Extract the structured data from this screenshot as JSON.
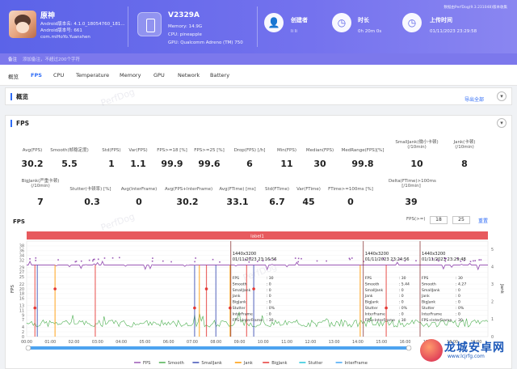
{
  "header": {
    "app": {
      "name": "原神",
      "version": "Android版本名: 4.1.0_18054760_181...",
      "version_code": "Android版本号: 661",
      "package": "com.miHoYo.Yuanshen"
    },
    "device": {
      "name": "V2329A",
      "memory": "Memory: 14.9G",
      "cpu": "CPU: pineapple",
      "gpu": "GPU: Qualcomm Adreno (TM) 750"
    },
    "stats": [
      {
        "label": "创建者",
        "value": "li li",
        "icon": "user-icon",
        "glyph": "👤"
      },
      {
        "label": "时长",
        "value": "0h 20m 0s",
        "icon": "clock-icon",
        "glyph": "◷"
      },
      {
        "label": "上传时间",
        "value": "01/11/2023 23:29:58",
        "icon": "upload-time-icon",
        "glyph": "◷"
      }
    ],
    "version_note": "数据由PerfDog(9.3.231048)版本收集"
  },
  "remark": {
    "label": "备注",
    "placeholder": "添加备注，不超过200个字符"
  },
  "tabs": [
    "概览",
    "FPS",
    "CPU",
    "Temperature",
    "Memory",
    "GPU",
    "Network",
    "Battery"
  ],
  "active_tab": "FPS",
  "overview": {
    "title": "概览",
    "export": "导出全部"
  },
  "fps_section": {
    "title": "FPS",
    "collapse_glyph": "▾",
    "metrics_row1": [
      {
        "label": "Avg(FPS)",
        "value": "30.2"
      },
      {
        "label": "Smooth(帧稳定度)",
        "value": "5.5"
      },
      {
        "label": "Std(FPS)",
        "value": "1"
      },
      {
        "label": "Var(FPS)",
        "value": "1.1"
      },
      {
        "label": "FPS>=18 [%]",
        "value": "99.9"
      },
      {
        "label": "FPS>=25 [%]",
        "value": "99.6"
      },
      {
        "label": "Drop(FPS) [/h]",
        "value": "6"
      },
      {
        "label": "Min(FPS)",
        "value": "11"
      },
      {
        "label": "Median(FPS)",
        "value": "30"
      },
      {
        "label": "MedRange(FPS)[%]",
        "value": "99.8"
      },
      {
        "label": "SmallJank(微小卡顿)\n(/10min)",
        "value": "10"
      },
      {
        "label": "Jank(卡顿)\n(/10min)",
        "value": "8"
      }
    ],
    "metrics_row2": [
      {
        "label": "BigJank(严重卡顿)\n(/10min)",
        "value": "7"
      },
      {
        "label": "Stutter(卡顿率) [%]",
        "value": "0.3"
      },
      {
        "label": "Avg(InterFrame)",
        "value": "0"
      },
      {
        "label": "Avg(FPS+InterFrame)",
        "value": "30.2"
      },
      {
        "label": "Avg(FTime) [ms]",
        "value": "33.1"
      },
      {
        "label": "Std(FTime)",
        "value": "6.7"
      },
      {
        "label": "Var(FTime)",
        "value": "45"
      },
      {
        "label": "FTime>=100ms [%]",
        "value": "0"
      },
      {
        "label": "Delta(FTime)>100ms\n[/10min]",
        "value": "39"
      }
    ]
  },
  "chart_controls": {
    "title": "FPS",
    "range_label": "FPS(>=)",
    "range_low": "18",
    "range_high": "25",
    "reset": "重置"
  },
  "watermark": "PerfDog",
  "chart_data": {
    "type": "line",
    "y_left_label": "FPS",
    "y_right_label": "Jank",
    "label_bar": "label1",
    "ylim": [
      0,
      40
    ],
    "y_ticks": [
      "0",
      "2",
      "4",
      "7",
      "9",
      "11",
      "13",
      "16",
      "18",
      "20",
      "22",
      "25",
      "27",
      "29",
      "32",
      "34",
      "36",
      "38"
    ],
    "y_right_ticks": [
      "0",
      "1",
      "2",
      "3",
      "4",
      "5"
    ],
    "x_ticks": [
      "00:00",
      "01:00",
      "02:00",
      "03:00",
      "04:00",
      "05:00",
      "06:00",
      "07:00",
      "08:00",
      "09:00",
      "10:00",
      "11:00",
      "12:00",
      "13:00",
      "14:00",
      "15:00",
      "16:00",
      "17:00",
      "18:00",
      "19:00"
    ],
    "legend": [
      {
        "name": "FPS",
        "color": "#9b59b6"
      },
      {
        "name": "Smooth",
        "color": "#4caf50"
      },
      {
        "name": "SmallJank",
        "color": "#3f51b5"
      },
      {
        "name": "Jank",
        "color": "#ff9800"
      },
      {
        "name": "BigJank",
        "color": "#e53935"
      },
      {
        "name": "Stutter",
        "color": "#26c6da"
      },
      {
        "name": "InterFrame",
        "color": "#42a5f5"
      }
    ],
    "fps_level": 30,
    "jank_events_minutes": [
      0.35,
      0.45,
      1.2,
      2.9,
      7.1,
      7.3,
      7.6,
      8.0,
      8.6,
      9.3,
      9.6,
      14.1,
      15.2
    ],
    "tooltips": [
      {
        "title": "1440x3200",
        "time": "01/11/2023 23:16:56",
        "rows": [
          [
            "FPS",
            ": 30"
          ],
          [
            "Smooth",
            ": 0"
          ],
          [
            "SmallJank",
            ": 0"
          ],
          [
            "Jank",
            ": 0"
          ],
          [
            "BigJank",
            ": 0"
          ],
          [
            "Stutter",
            ": 0%"
          ],
          [
            "InterFrame",
            ": 0"
          ],
          [
            "FPS+InterFrame",
            ": 30"
          ]
        ]
      },
      {
        "title": "1440x3200",
        "time": "01/11/2023 23:24:56",
        "rows": [
          [
            "FPS",
            ": 30"
          ],
          [
            "Smooth",
            ": 5.44"
          ],
          [
            "SmallJank",
            ": 0"
          ],
          [
            "Jank",
            ": 0"
          ],
          [
            "BigJank",
            ": 0"
          ],
          [
            "Stutter",
            ": 0%"
          ],
          [
            "InterFrame",
            ": 0"
          ],
          [
            "FPS+InterFrame",
            ": 30"
          ]
        ]
      },
      {
        "title": "1440x3200",
        "time": "01/11/2023 23:29:48",
        "rows": [
          [
            "FPS",
            ": 30"
          ],
          [
            "Smooth",
            ": 4.27"
          ],
          [
            "SmallJank",
            ": 0"
          ],
          [
            "Jank",
            ": 0"
          ],
          [
            "BigJank",
            ": 0"
          ],
          [
            "Stutter",
            ": 0%"
          ],
          [
            "InterFrame",
            ": 0"
          ],
          [
            "FPS+InterFrame",
            ": 30"
          ]
        ]
      }
    ]
  },
  "brand": {
    "name": "龙城安卓网",
    "url": "www.lcjrfg.com"
  }
}
